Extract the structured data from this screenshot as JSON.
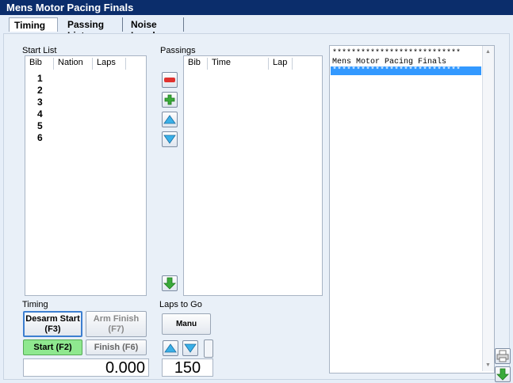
{
  "window": {
    "title": "Mens Motor Pacing Finals"
  },
  "tabs": [
    {
      "label": "Timing",
      "active": true
    },
    {
      "label": "Passing List",
      "active": false
    },
    {
      "label": "Noise Level",
      "active": false
    }
  ],
  "start_list": {
    "label": "Start List",
    "columns": [
      "Bib",
      "Nation",
      "Laps"
    ],
    "bibs": [
      "1",
      "2",
      "3",
      "4",
      "5",
      "6"
    ]
  },
  "passings": {
    "label": "Passings",
    "columns": [
      "Bib",
      "Time",
      "Lap"
    ]
  },
  "printout": {
    "lines": [
      "***************************",
      "Mens Motor Pacing Finals",
      "***************************"
    ]
  },
  "timing": {
    "label": "Timing",
    "desarm_start": "Desarm Start\n(F3)",
    "arm_finish": "Arm Finish\n(F7)",
    "start": "Start (F2)",
    "finish": "Finish (F6)",
    "time_value": "0.000"
  },
  "laps_to_go": {
    "label": "Laps to Go",
    "manu": "Manu",
    "value": "150"
  },
  "colors": {
    "titlebar": "#0b2d6b",
    "selection": "#3399ff",
    "start_green": "#8fe88f"
  }
}
